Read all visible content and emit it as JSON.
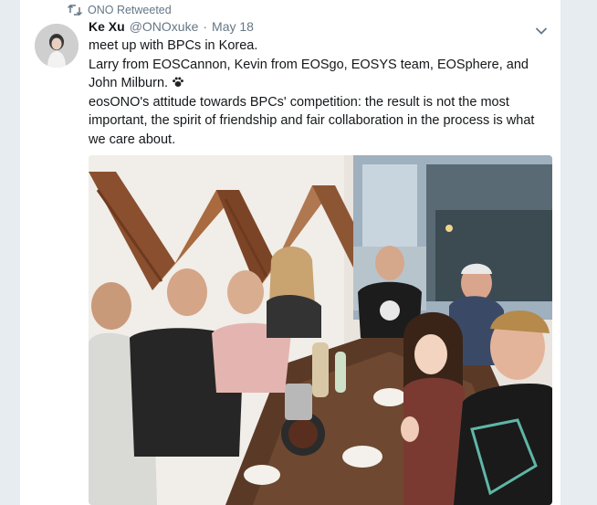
{
  "retweet": {
    "label": "ONO Retweeted",
    "icon": "retweet-icon"
  },
  "tweet": {
    "author_name": "Ke Xu",
    "handle": "@ONOxuke",
    "separator": "·",
    "date": "May 18",
    "lines": [
      "meet up with BPCs in Korea.",
      "Larry from EOSCannon, Kevin from EOSgo, EOSYS team, EOSphere, and John Milburn.",
      "eosONO's attitude towards BPCs' competition: the result is not the most important, the spirit of friendship and fair collaboration in the process is what we care about."
    ]
  },
  "icons": {
    "retweet": "retweet-icon",
    "more": "chevron-down-icon",
    "emoji": "paw-emoji-icon"
  },
  "colors": {
    "name": "#14171a",
    "secondary": "#657786",
    "background": "#e6ecf0",
    "card": "#ffffff"
  }
}
